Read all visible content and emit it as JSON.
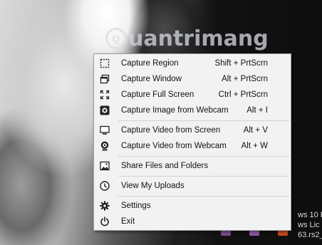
{
  "watermark": {
    "text": "uantrimang",
    "logo_glyph": "Q"
  },
  "desktop_text": [
    "ws 10 E",
    "ws Lic",
    "63.rs2_"
  ],
  "menu": {
    "groups": [
      [
        {
          "label": "Capture Region",
          "shortcut": "Shift + PrtScrn",
          "icon": "region-icon"
        },
        {
          "label": "Capture Window",
          "shortcut": "Alt + PrtScrn",
          "icon": "window-icon"
        },
        {
          "label": "Capture Full Screen",
          "shortcut": "Ctrl + PrtScrn",
          "icon": "fullscreen-icon"
        },
        {
          "label": "Capture Image from Webcam",
          "shortcut": "Alt + I",
          "icon": "webcam-image-icon"
        }
      ],
      [
        {
          "label": "Capture Video from Screen",
          "shortcut": "Alt + V",
          "icon": "monitor-icon"
        },
        {
          "label": "Capture Video from Webcam",
          "shortcut": "Alt + W",
          "icon": "webcam-icon"
        }
      ],
      [
        {
          "label": "Share Files and Folders",
          "shortcut": "",
          "icon": "image-icon"
        }
      ],
      [
        {
          "label": "View My Uploads",
          "shortcut": "",
          "icon": "clock-icon"
        }
      ],
      [
        {
          "label": "Settings",
          "shortcut": "",
          "icon": "gear-icon"
        },
        {
          "label": "Exit",
          "shortcut": "",
          "icon": "power-icon"
        }
      ]
    ]
  },
  "colors": {
    "menu_bg": "#f2f2f2",
    "menu_border": "#a0a0a0",
    "text": "#111111"
  }
}
